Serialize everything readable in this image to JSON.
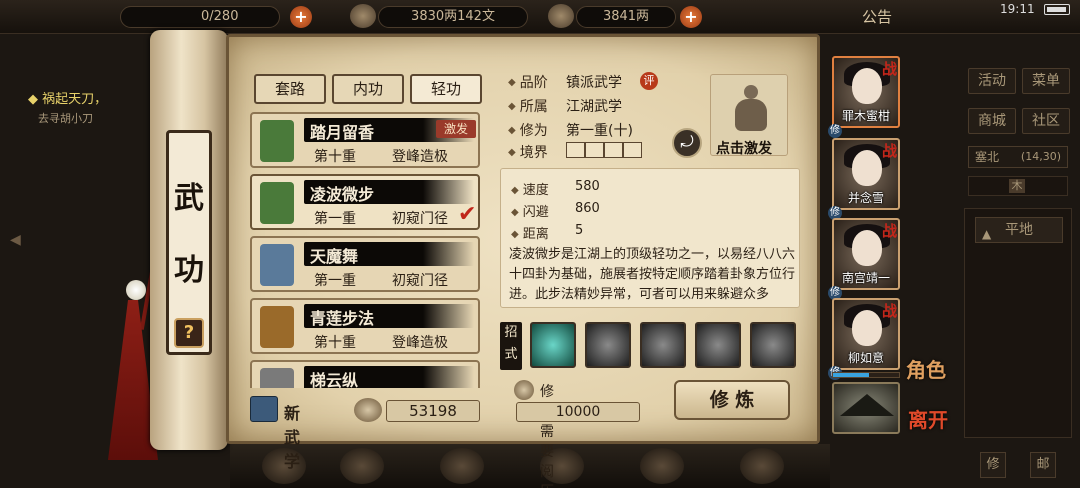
{
  "topbar": {
    "stamina": "0/280",
    "copper": "3830两142文",
    "silver": "3841两",
    "notice": "公告",
    "time": "19:11"
  },
  "quest": {
    "title": "◆ 祸起天刀，",
    "subtitle": "去寻胡小刀"
  },
  "scroll": {
    "title_chars": [
      "武",
      "功"
    ],
    "help": "?"
  },
  "tabs": [
    {
      "label": "套路"
    },
    {
      "label": "内功"
    },
    {
      "label": "轻功"
    }
  ],
  "skills": [
    {
      "name": "踏月留香",
      "level": "第十重",
      "stage": "登峰造极",
      "badge": "激发",
      "icon_color": "#4a7a3a"
    },
    {
      "name": "凌波微步",
      "level": "第一重",
      "stage": "初窥门径",
      "icon_color": "#4a7a3a"
    },
    {
      "name": "天魔舞",
      "level": "第一重",
      "stage": "初窥门径",
      "icon_color": "#5a7a9a"
    },
    {
      "name": "青莲步法",
      "level": "第十重",
      "stage": "登峰造极",
      "icon_color": "#9a6a2a"
    },
    {
      "name": "梯云纵",
      "level": "",
      "stage": "",
      "icon_color": "#7a7a7a"
    }
  ],
  "footer": {
    "new_skill": "新武学",
    "exp": "53198"
  },
  "detail": {
    "grade_label": "品阶",
    "grade": "镇派武学",
    "rating": "评",
    "school_label": "所属",
    "school": "江湖武学",
    "cultivation_label": "修为",
    "cultivation": "第一重(十)",
    "realm_label": "境界",
    "activate_label": "点击激发",
    "stats": [
      {
        "label": "速度",
        "value": "580"
      },
      {
        "label": "闪避",
        "value": "860"
      },
      {
        "label": "距离",
        "value": "5"
      }
    ],
    "description": "凌波微步是江湖上的顶级轻功之一，以易经八八六十四卦为基础，施展者按特定顺序踏着卦象方位行进。此步法精妙异常，可者可以用来躲避众多",
    "moves_label": "招式",
    "requirement_label": "修炼需要阅历",
    "requirement": "10000",
    "train_button": "修 炼"
  },
  "roster": [
    {
      "name": "罪木蜜柑",
      "tag": "战",
      "active": true
    },
    {
      "name": "并念雪",
      "tag": "战"
    },
    {
      "name": "南宫靖一",
      "tag": "战"
    },
    {
      "name": "柳如意",
      "tag": "战",
      "hp": 0.55
    }
  ],
  "roster_skill_tag": "修",
  "side_actions": {
    "role": "角色",
    "leave": "离开"
  },
  "menu": {
    "activity": "活动",
    "menu": "菜单",
    "shop": "商城",
    "community": "社区",
    "location": "塞北",
    "coords": "(14,30)",
    "compass": "木",
    "terrain": "平地"
  },
  "dock_labels": [
    "修",
    "邮"
  ]
}
